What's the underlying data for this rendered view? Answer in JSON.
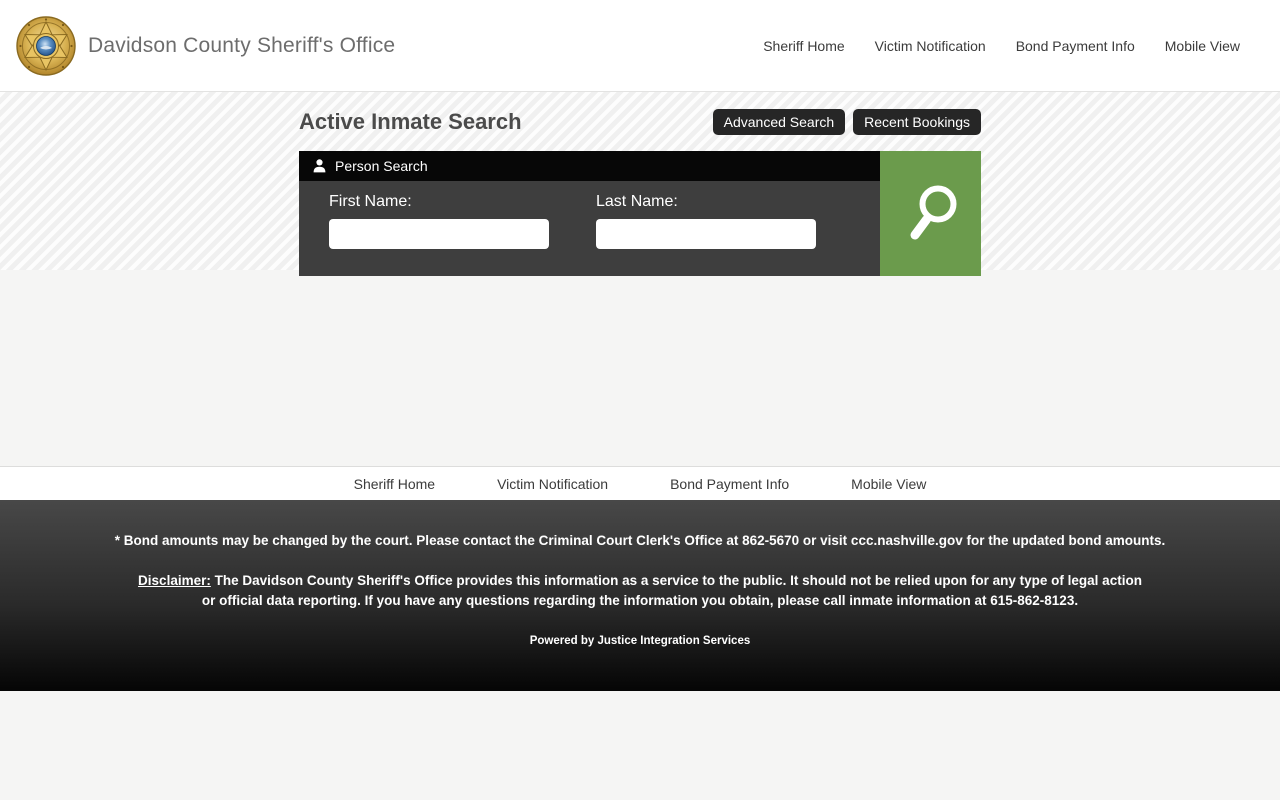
{
  "header": {
    "title": "Davidson County Sheriff's Office",
    "nav": [
      {
        "label": "Sheriff Home"
      },
      {
        "label": "Victim Notification"
      },
      {
        "label": "Bond Payment Info"
      },
      {
        "label": "Mobile View"
      }
    ]
  },
  "main": {
    "page_title": "Active Inmate Search",
    "advanced_search_label": "Advanced Search",
    "recent_bookings_label": "Recent Bookings",
    "person_search": {
      "panel_title": "Person Search",
      "first_name_label": "First Name:",
      "first_name_value": "",
      "last_name_label": "Last Name:",
      "last_name_value": ""
    }
  },
  "footer_nav": [
    {
      "label": "Sheriff Home"
    },
    {
      "label": "Victim Notification"
    },
    {
      "label": "Bond Payment Info"
    },
    {
      "label": "Mobile View"
    }
  ],
  "footer": {
    "bond_notice": "* Bond amounts may be changed by the court. Please contact the Criminal Court Clerk's Office at 862-5670 or visit ccc.nashville.gov for the updated bond amounts.",
    "disclaimer_label": "Disclaimer:",
    "disclaimer_text": " The Davidson County Sheriff's Office provides this information as a service to the public. It should not be relied upon for any type of legal action or official data reporting. If you have any questions regarding the information you obtain, please call inmate information at 615-862-8123.",
    "powered_by_prefix": "Powered by ",
    "powered_by_link": "Justice Integration Services"
  },
  "icons": {
    "logo": "sheriff-badge-star",
    "panel": "person-silhouette",
    "search": "magnifying-glass"
  },
  "colors": {
    "accent_green": "#6b9b4c",
    "button_dark": "#262626",
    "panel_header": "#070707",
    "panel_body": "#3e3e3e",
    "footer_gradient_top": "#484848",
    "footer_gradient_bottom": "#050505",
    "page_background": "#f5f5f4"
  }
}
